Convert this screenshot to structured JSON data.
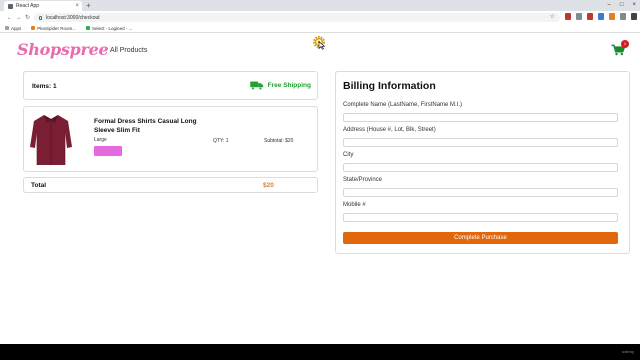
{
  "browser": {
    "tab_title": "React App",
    "url": "localhost:3000/checkout",
    "bookmarks": [
      "Apps",
      "PlexSpider Room...",
      "Select - Logined - ..."
    ]
  },
  "header": {
    "logo": "Shopspree",
    "nav_link": "All Products",
    "cart_count": "1"
  },
  "summary": {
    "items_label": "Items: 1",
    "shipping_label": "Free Shipping"
  },
  "product": {
    "name": "Formal Dress Shirts Casual Long Sleeve Slim Fit",
    "size": "Large",
    "qty": "QTY: 1",
    "subtotal": "Subtotal: $20",
    "swatch_color": "#e56ae0"
  },
  "total": {
    "label": "Total",
    "value": "$20"
  },
  "billing": {
    "title": "Billing Information",
    "fields": [
      {
        "label": "Complete Name (LastName, FirstName M.I.)",
        "value": ""
      },
      {
        "label": "Address (House #, Lot, Blk, Street)",
        "value": ""
      },
      {
        "label": "City",
        "value": ""
      },
      {
        "label": "State/Province",
        "value": ""
      },
      {
        "label": "Mobile #",
        "value": ""
      }
    ],
    "button_label": "Complete Purchase"
  },
  "colors": {
    "brand_pink": "#e86bb0",
    "shipping_green": "#21a12e",
    "total_orange": "#d9822b",
    "button_orange": "#e0670c"
  },
  "footer": {
    "watermark": "udemy"
  }
}
